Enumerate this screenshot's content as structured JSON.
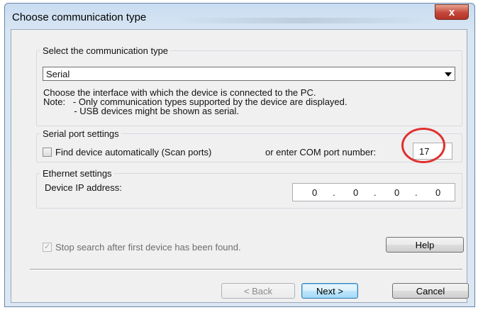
{
  "window": {
    "title": "Choose communication type",
    "close_label": "x"
  },
  "comm_type": {
    "legend": "Select the communication type",
    "selected": "Serial",
    "info_line1": "Choose the interface with which the device is connected to the PC.",
    "info_line2": "Note:   - Only communication types supported by the device are displayed.",
    "info_line3": "            - USB devices might be shown as serial."
  },
  "serial": {
    "legend": "Serial port settings",
    "find_auto_label": "Find device automatically (Scan ports)",
    "find_auto_checked": false,
    "com_port_label": "or enter COM port number:",
    "com_port_value": "17"
  },
  "ethernet": {
    "legend": "Ethernet settings",
    "ip_label": "Device IP address:",
    "ip_octets": [
      "0",
      "0",
      "0",
      "0"
    ],
    "dot": "."
  },
  "options": {
    "stop_search_label": "Stop search after first device has been found.",
    "stop_search_checked": true,
    "help_label": "Help"
  },
  "footer": {
    "back_label": "< Back",
    "next_label": "Next >",
    "cancel_label": "Cancel"
  },
  "colors": {
    "highlight_circle": "#e03030",
    "default_button_border": "#3c7fb1"
  }
}
